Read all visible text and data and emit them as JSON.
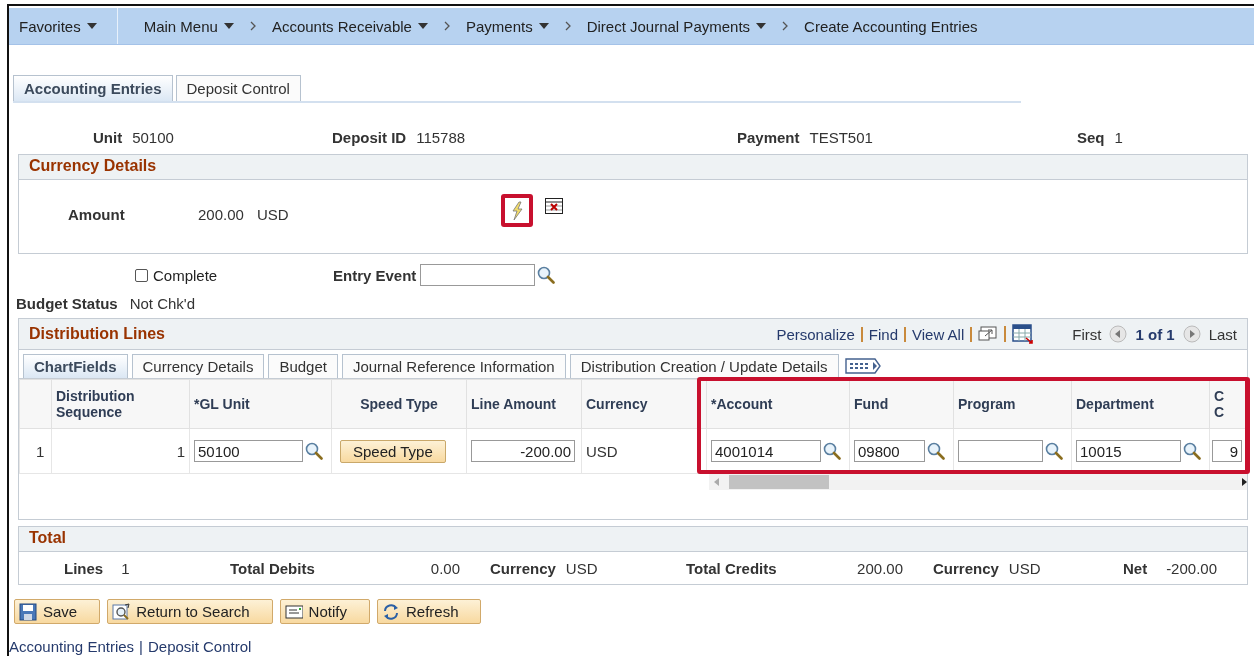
{
  "nav": [
    {
      "label": "Favorites",
      "dropdown": true,
      "chevron": false
    },
    {
      "label": "Main Menu",
      "dropdown": true,
      "chevron": false
    },
    {
      "label": "Accounts Receivable",
      "dropdown": true,
      "chevron": true
    },
    {
      "label": "Payments",
      "dropdown": true,
      "chevron": true
    },
    {
      "label": "Direct Journal Payments",
      "dropdown": true,
      "chevron": true
    },
    {
      "label": "Create Accounting Entries",
      "dropdown": false,
      "chevron": true
    }
  ],
  "tabs": [
    {
      "label": "Accounting Entries",
      "selected": true
    },
    {
      "label": "Deposit Control",
      "selected": false
    }
  ],
  "header_fields": [
    {
      "label": "Unit",
      "value": "50100"
    },
    {
      "label": "Deposit ID",
      "value": "115788"
    },
    {
      "label": "Payment",
      "value": "TEST501"
    },
    {
      "label": "Seq",
      "value": "1"
    }
  ],
  "currency_details": {
    "title": "Currency Details",
    "amount_label": "Amount",
    "amount": "200.00",
    "currency": "USD",
    "calculate_highlighted": true
  },
  "complete": {
    "label": "Complete",
    "checked": false
  },
  "entry_event": {
    "label": "Entry Event"
  },
  "budget_status": {
    "label": "Budget Status",
    "value": "Not Chk'd"
  },
  "distribution": {
    "title": "Distribution Lines",
    "links": [
      "Personalize",
      "Find",
      "View All"
    ],
    "pager": {
      "first": "First",
      "count": "1 of 1",
      "last": "Last"
    },
    "tabs": [
      {
        "label": "ChartFields",
        "selected": true
      },
      {
        "label": "Currency Details",
        "selected": false
      },
      {
        "label": "Budget",
        "selected": false
      },
      {
        "label": "Journal Reference Information",
        "selected": false
      },
      {
        "label": "Distribution Creation / Update Details",
        "selected": false
      }
    ],
    "columns": [
      {
        "highlighted": false
      },
      {
        "label": "Distribution Sequence",
        "highlighted": false
      },
      {
        "label": "*GL Unit",
        "highlighted": false
      },
      {
        "label": "Speed Type",
        "highlighted": false
      },
      {
        "label": "Line Amount",
        "highlighted": false
      },
      {
        "label": "Currency",
        "highlighted": false
      },
      {
        "label": "*Account",
        "highlighted": true
      },
      {
        "label": "Fund",
        "highlighted": true
      },
      {
        "label": "Program",
        "highlighted": true
      },
      {
        "label": "Department",
        "highlighted": true
      },
      {
        "label": "C C",
        "highlighted": true
      }
    ],
    "rows": [
      {
        "cells": [
          {
            "kind": "text",
            "value": "1"
          },
          {
            "kind": "text",
            "value": "1"
          },
          {
            "kind": "lookup",
            "value": "50100"
          },
          {
            "kind": "button",
            "value": "Speed Type"
          },
          {
            "kind": "input",
            "value": "-200.00"
          },
          {
            "kind": "text",
            "value": "USD"
          },
          {
            "kind": "lookup",
            "value": "4001014"
          },
          {
            "kind": "lookup",
            "value": "09800"
          },
          {
            "kind": "lookup"
          },
          {
            "kind": "lookup",
            "value": "10015"
          },
          {
            "kind": "input",
            "value": "9"
          }
        ]
      }
    ]
  },
  "total": {
    "title": "Total",
    "fields": [
      {
        "label": "Lines",
        "value": "1"
      },
      {
        "label": "Total Debits",
        "value": "0.00"
      },
      {
        "label": "Currency",
        "value": "USD"
      },
      {
        "label": "Total Credits",
        "value": "200.00"
      },
      {
        "label": "Currency",
        "value": "USD"
      },
      {
        "label": "Net",
        "value": "-200.00"
      }
    ]
  },
  "buttons": [
    {
      "label": "Save",
      "kind": "save"
    },
    {
      "label": "Return to Search",
      "kind": "search"
    },
    {
      "label": "Notify",
      "kind": "notify"
    },
    {
      "label": "Refresh",
      "kind": "refresh"
    }
  ],
  "footer_links": [
    "Accounting Entries",
    "Deposit Control"
  ],
  "footer_separator": "|"
}
